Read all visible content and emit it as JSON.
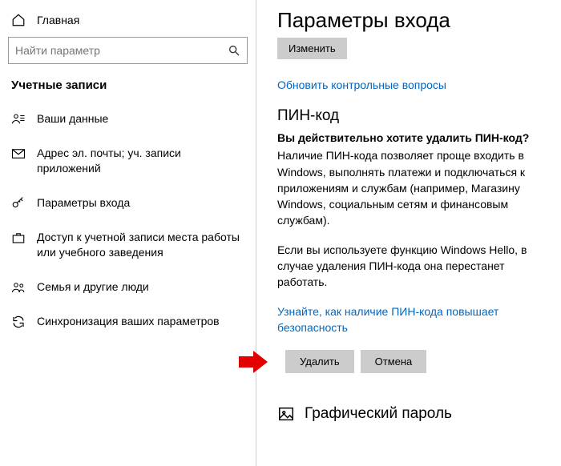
{
  "sidebar": {
    "home_label": "Главная",
    "search_placeholder": "Найти параметр",
    "section_title": "Учетные записи",
    "items": [
      {
        "label": "Ваши данные"
      },
      {
        "label": "Адрес эл. почты; уч. записи приложений"
      },
      {
        "label": "Параметры входа"
      },
      {
        "label": "Доступ к учетной записи места работы или учебного заведения"
      },
      {
        "label": "Семья и другие люди"
      },
      {
        "label": "Синхронизация ваших параметров"
      }
    ]
  },
  "main": {
    "title": "Параметры входа",
    "change_btn": "Изменить",
    "update_questions_link": "Обновить контрольные вопросы",
    "pin_heading": "ПИН-код",
    "confirm_question": "Вы действительно хотите удалить ПИН-код?",
    "desc1": "Наличие ПИН-кода позволяет проще входить в Windows, выполнять платежи и подключаться к приложениям и службам (например, Магазину Windows, социальным сетям и финансовым службам).",
    "desc2": "Если вы используете функцию Windows Hello, в случае удаления ПИН-кода она перестанет работать.",
    "learn_link": "Узнайте, как наличие ПИН-кода повышает безопасность",
    "delete_btn": "Удалить",
    "cancel_btn": "Отмена",
    "picture_password_heading": "Графический пароль"
  }
}
